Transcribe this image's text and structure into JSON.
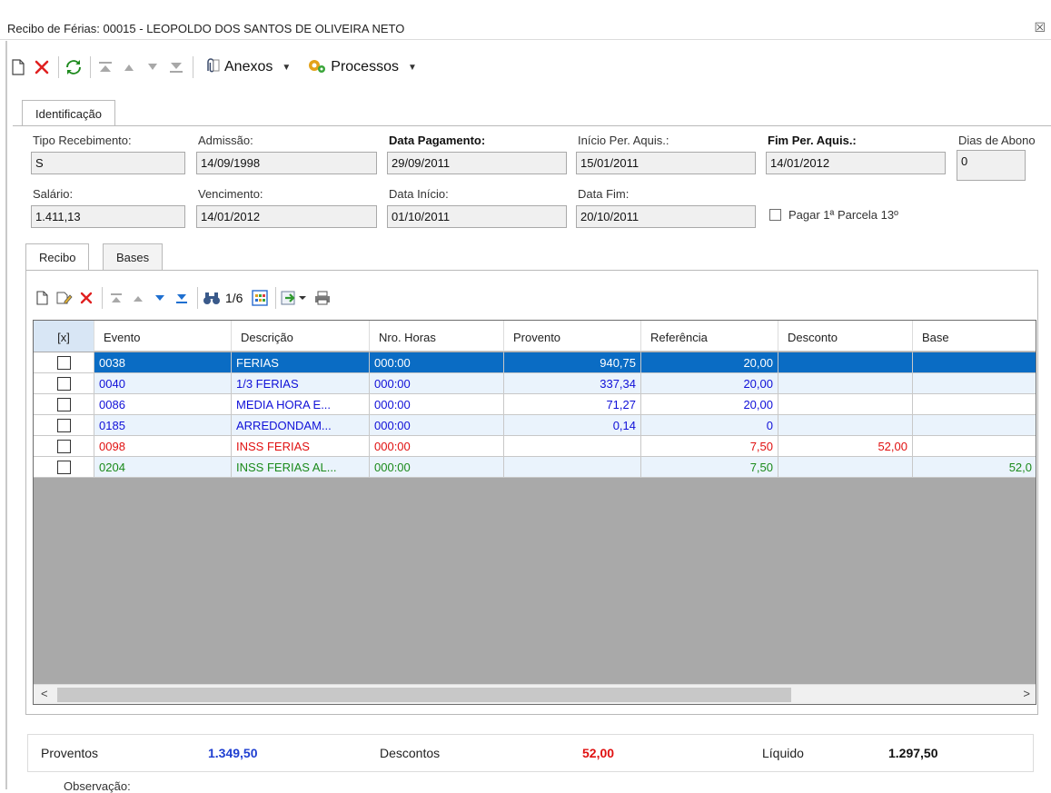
{
  "window": {
    "title": "Recibo de Férias: 00015 - LEOPOLDO DOS SANTOS DE OLIVEIRA NETO",
    "close_glyph": "☒"
  },
  "toolbar": {
    "attachments_label": "Anexos",
    "processes_label": "Processos"
  },
  "outer_tab": {
    "label": "Identificação"
  },
  "fields": {
    "tipo_recebimento": {
      "label": "Tipo Recebimento:",
      "value": "S"
    },
    "admissao": {
      "label": "Admissão:",
      "value": "14/09/1998"
    },
    "data_pagamento": {
      "label": "Data Pagamento:",
      "value": "29/09/2011"
    },
    "inicio_per_aquis": {
      "label": "Início Per. Aquis.:",
      "value": "15/01/2011"
    },
    "fim_per_aquis": {
      "label": "Fim Per. Aquis.:",
      "value": "14/01/2012"
    },
    "dias_abono": {
      "label": "Dias de Abono",
      "value": "0"
    },
    "salario": {
      "label": "Salário:",
      "value": "1.411,13"
    },
    "vencimento": {
      "label": "Vencimento:",
      "value": "14/01/2012"
    },
    "data_inicio": {
      "label": "Data Início:",
      "value": "01/10/2011"
    },
    "data_fim": {
      "label": "Data Fim:",
      "value": "20/10/2011"
    },
    "pagar_parcela": {
      "label": "Pagar 1ª Parcela 13º",
      "checked": false
    }
  },
  "inner_tabs": [
    {
      "label": "Recibo",
      "active": true
    },
    {
      "label": "Bases",
      "active": false
    }
  ],
  "grid_toolbar": {
    "pager": "1/6"
  },
  "grid": {
    "columns": [
      "[x]",
      "Evento",
      "Descrição",
      "Nro. Horas",
      "Provento",
      "Referência",
      "Desconto",
      "Base"
    ],
    "rows": [
      {
        "evento": "0038",
        "descricao": "FERIAS",
        "horas": "000:00",
        "provento": "940,75",
        "referencia": "20,00",
        "desconto": "",
        "base": "",
        "color": "#ffffff",
        "bg": "#0a6cc4"
      },
      {
        "evento": "0040",
        "descricao": "1/3 FERIAS",
        "horas": "000:00",
        "provento": "337,34",
        "referencia": "20,00",
        "desconto": "",
        "base": "",
        "color": "#1010d8",
        "bg": "#eaf3fc"
      },
      {
        "evento": "0086",
        "descricao": "MEDIA HORA E...",
        "horas": "000:00",
        "provento": "71,27",
        "referencia": "20,00",
        "desconto": "",
        "base": "",
        "color": "#1010d8",
        "bg": "#ffffff"
      },
      {
        "evento": "0185",
        "descricao": "ARREDONDAM...",
        "horas": "000:00",
        "provento": "0,14",
        "referencia": "0",
        "desconto": "",
        "base": "",
        "color": "#1010d8",
        "bg": "#eaf3fc"
      },
      {
        "evento": "0098",
        "descricao": "INSS FERIAS",
        "horas": "000:00",
        "provento": "",
        "referencia": "7,50",
        "desconto": "52,00",
        "base": "",
        "color": "#e01010",
        "bg": "#ffffff"
      },
      {
        "evento": "0204",
        "descricao": "INSS FERIAS AL...",
        "horas": "000:00",
        "provento": "",
        "referencia": "7,50",
        "desconto": "",
        "base": "52,0",
        "color": "#1a8a1a",
        "bg": "#eaf3fc"
      }
    ]
  },
  "totals": {
    "proventos_label": "Proventos",
    "proventos_value": "1.349,50",
    "descontos_label": "Descontos",
    "descontos_value": "52,00",
    "liquido_label": "Líquido",
    "liquido_value": "1.297,50",
    "colors": {
      "proventos": "#1f3fd1",
      "descontos": "#e01010",
      "liquido": "#111111"
    }
  },
  "observacao_label": "Observação:"
}
